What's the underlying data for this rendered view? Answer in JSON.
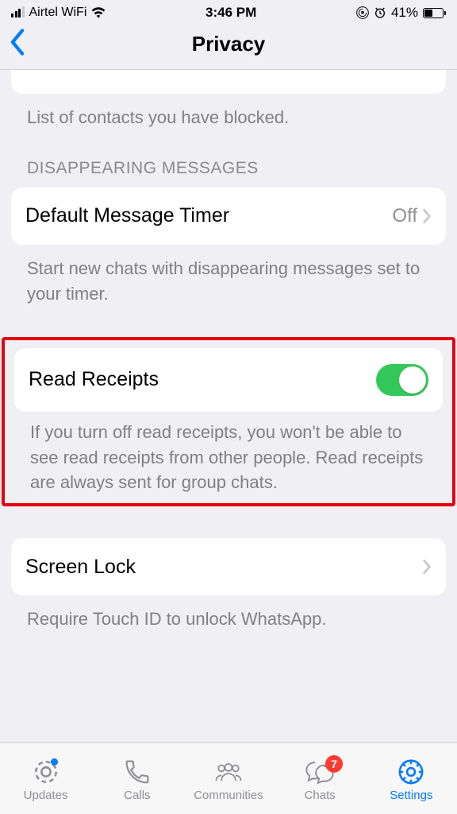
{
  "status": {
    "carrier": "Airtel WiFi",
    "time": "3:46 PM",
    "battery_pct": "41%"
  },
  "nav": {
    "title": "Privacy"
  },
  "blocked": {
    "footer": "List of contacts you have blocked."
  },
  "disappearing": {
    "header": "Disappearing Messages",
    "timer_label": "Default Message Timer",
    "timer_value": "Off",
    "footer": "Start new chats with disappearing messages set to your timer."
  },
  "read_receipts": {
    "label": "Read Receipts",
    "footer": "If you turn off read receipts, you won't be able to see read receipts from other people. Read receipts are always sent for group chats."
  },
  "screen_lock": {
    "label": "Screen Lock",
    "footer": "Require Touch ID to unlock WhatsApp."
  },
  "tabs": {
    "updates": "Updates",
    "calls": "Calls",
    "communities": "Communities",
    "chats": "Chats",
    "settings": "Settings",
    "chats_badge": "7"
  }
}
